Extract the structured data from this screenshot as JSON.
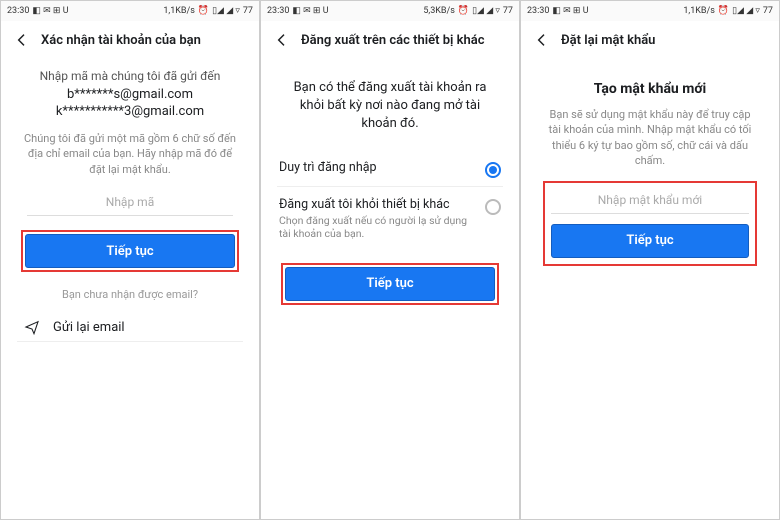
{
  "status": {
    "time": "23:30",
    "net1": "1,1KB/s",
    "net2": "5,3KB/s",
    "battery": "77"
  },
  "screen1": {
    "title": "Xác nhận tài khoản của bạn",
    "intro": "Nhập mã mà chúng tôi đã gửi đến",
    "email1": "b*******s@gmail.com",
    "email2": "k***********3@gmail.com",
    "hint": "Chúng tôi đã gửi một mã gồm 6 chữ số đến địa chỉ email của bạn. Hãy nhập mã đó để đặt lại mật khẩu.",
    "placeholder": "Nhập mã",
    "button": "Tiếp tục",
    "noemail": "Bạn chưa nhận được email?",
    "resend": "Gửi lại email"
  },
  "screen2": {
    "title": "Đăng xuất trên các thiết bị khác",
    "msg": "Bạn có thể đăng xuất tài khoản ra khỏi bất kỳ nơi nào đang mở tài khoản đó.",
    "opt1": "Duy trì đăng nhập",
    "opt2": "Đăng xuất tôi khỏi thiết bị khác",
    "opt2_sub": "Chọn đăng xuất nếu có người lạ sử dụng tài khoản của bạn.",
    "button": "Tiếp tục"
  },
  "screen3": {
    "title": "Đặt lại mật khẩu",
    "heading": "Tạo mật khẩu mới",
    "msg": "Bạn sẽ sử dụng mật khẩu này để truy cập tài khoản của mình.\nNhập mật khẩu có tối thiểu 6 ký tự bao gồm số, chữ cái và dấu chấm.",
    "placeholder": "Nhập mật khẩu mới",
    "button": "Tiếp tục"
  }
}
